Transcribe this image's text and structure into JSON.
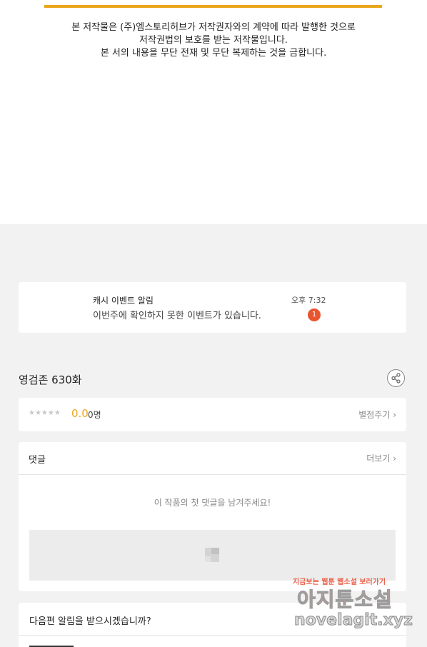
{
  "copyright": {
    "line1": "본 저작물은 (주)엠스토리허브가 저작권자와의 계약에 따라 발행한 것으로",
    "line2": "저작권법의 보호를 받는 저작물입니다.",
    "line3": "본 서의 내용을 무단 전재 및 무단 복제하는 것을 금합니다."
  },
  "notification": {
    "title": "캐시 이벤트 알림",
    "message": "이번주에 확인하지 못한 이벤트가 있습니다.",
    "time": "오후 7:32",
    "badge": "1"
  },
  "episode": {
    "title": "영검존 630화"
  },
  "rating": {
    "stars": "★★★★★",
    "score": "0.0",
    "count": "0명",
    "rate_label": "별점주기 ›",
    "level": 0
  },
  "comments": {
    "title": "댓글",
    "more_label": "더보기 ›",
    "empty_message": "이 작품의 첫 댓글을 남겨주세요!"
  },
  "next_episode": {
    "title": "다음편 알림을 받으시겠습니까?"
  },
  "watermark": {
    "tagline": "지금보는 웹툰 웹소설 보러가기",
    "name": "아지툰소설",
    "url": "novelagit.xyz"
  },
  "colors": {
    "accent": "#e9a71c",
    "badge": "#e8552e"
  }
}
